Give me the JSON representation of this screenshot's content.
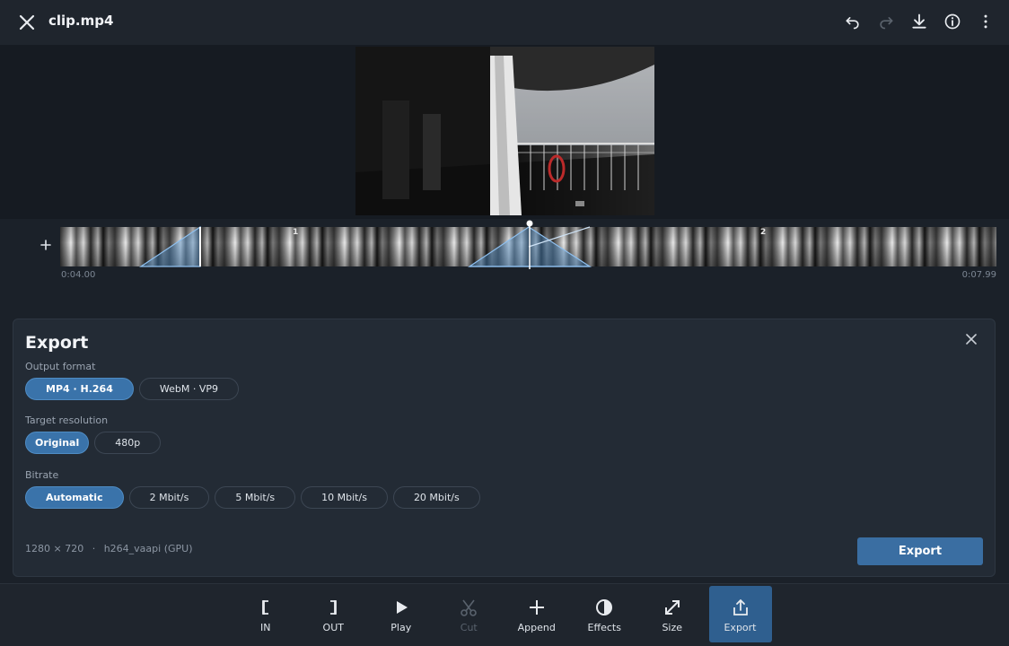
{
  "header": {
    "title": "clip.mp4",
    "icons": [
      "close-icon",
      "undo-icon",
      "redo-icon",
      "download-icon",
      "info-icon",
      "more-vert-icon"
    ]
  },
  "timeline": {
    "segments": [
      "1",
      "2"
    ],
    "start_time": "0:04.00",
    "end_time": "0:07.99"
  },
  "export_panel": {
    "title": "Export",
    "output_format": {
      "label": "Output format",
      "options": [
        "MP4 · H.264",
        "WebM · VP9"
      ],
      "selected": "MP4 · H.264"
    },
    "target_resolution": {
      "label": "Target resolution",
      "options": [
        "Original",
        "480p"
      ],
      "selected": "Original"
    },
    "bitrate": {
      "label": "Bitrate",
      "options": [
        "Automatic",
        "2 Mbit/s",
        "5 Mbit/s",
        "10 Mbit/s",
        "20 Mbit/s"
      ],
      "selected": "Automatic"
    },
    "specs": {
      "resolution": "1280 × 720",
      "separator": "·",
      "encoder": "h264_vaapi (GPU)"
    },
    "export_button": "Export"
  },
  "toolbar": {
    "in": "IN",
    "out": "OUT",
    "play": "Play",
    "cut": "Cut",
    "append": "Append",
    "effects": "Effects",
    "size": "Size",
    "export": "Export",
    "active": "Export",
    "disabled": [
      "Cut"
    ]
  },
  "colors": {
    "accent": "#3a73aa",
    "background": "#1b2129",
    "panel": "#232b35",
    "highlight": "#7fb5ea"
  }
}
